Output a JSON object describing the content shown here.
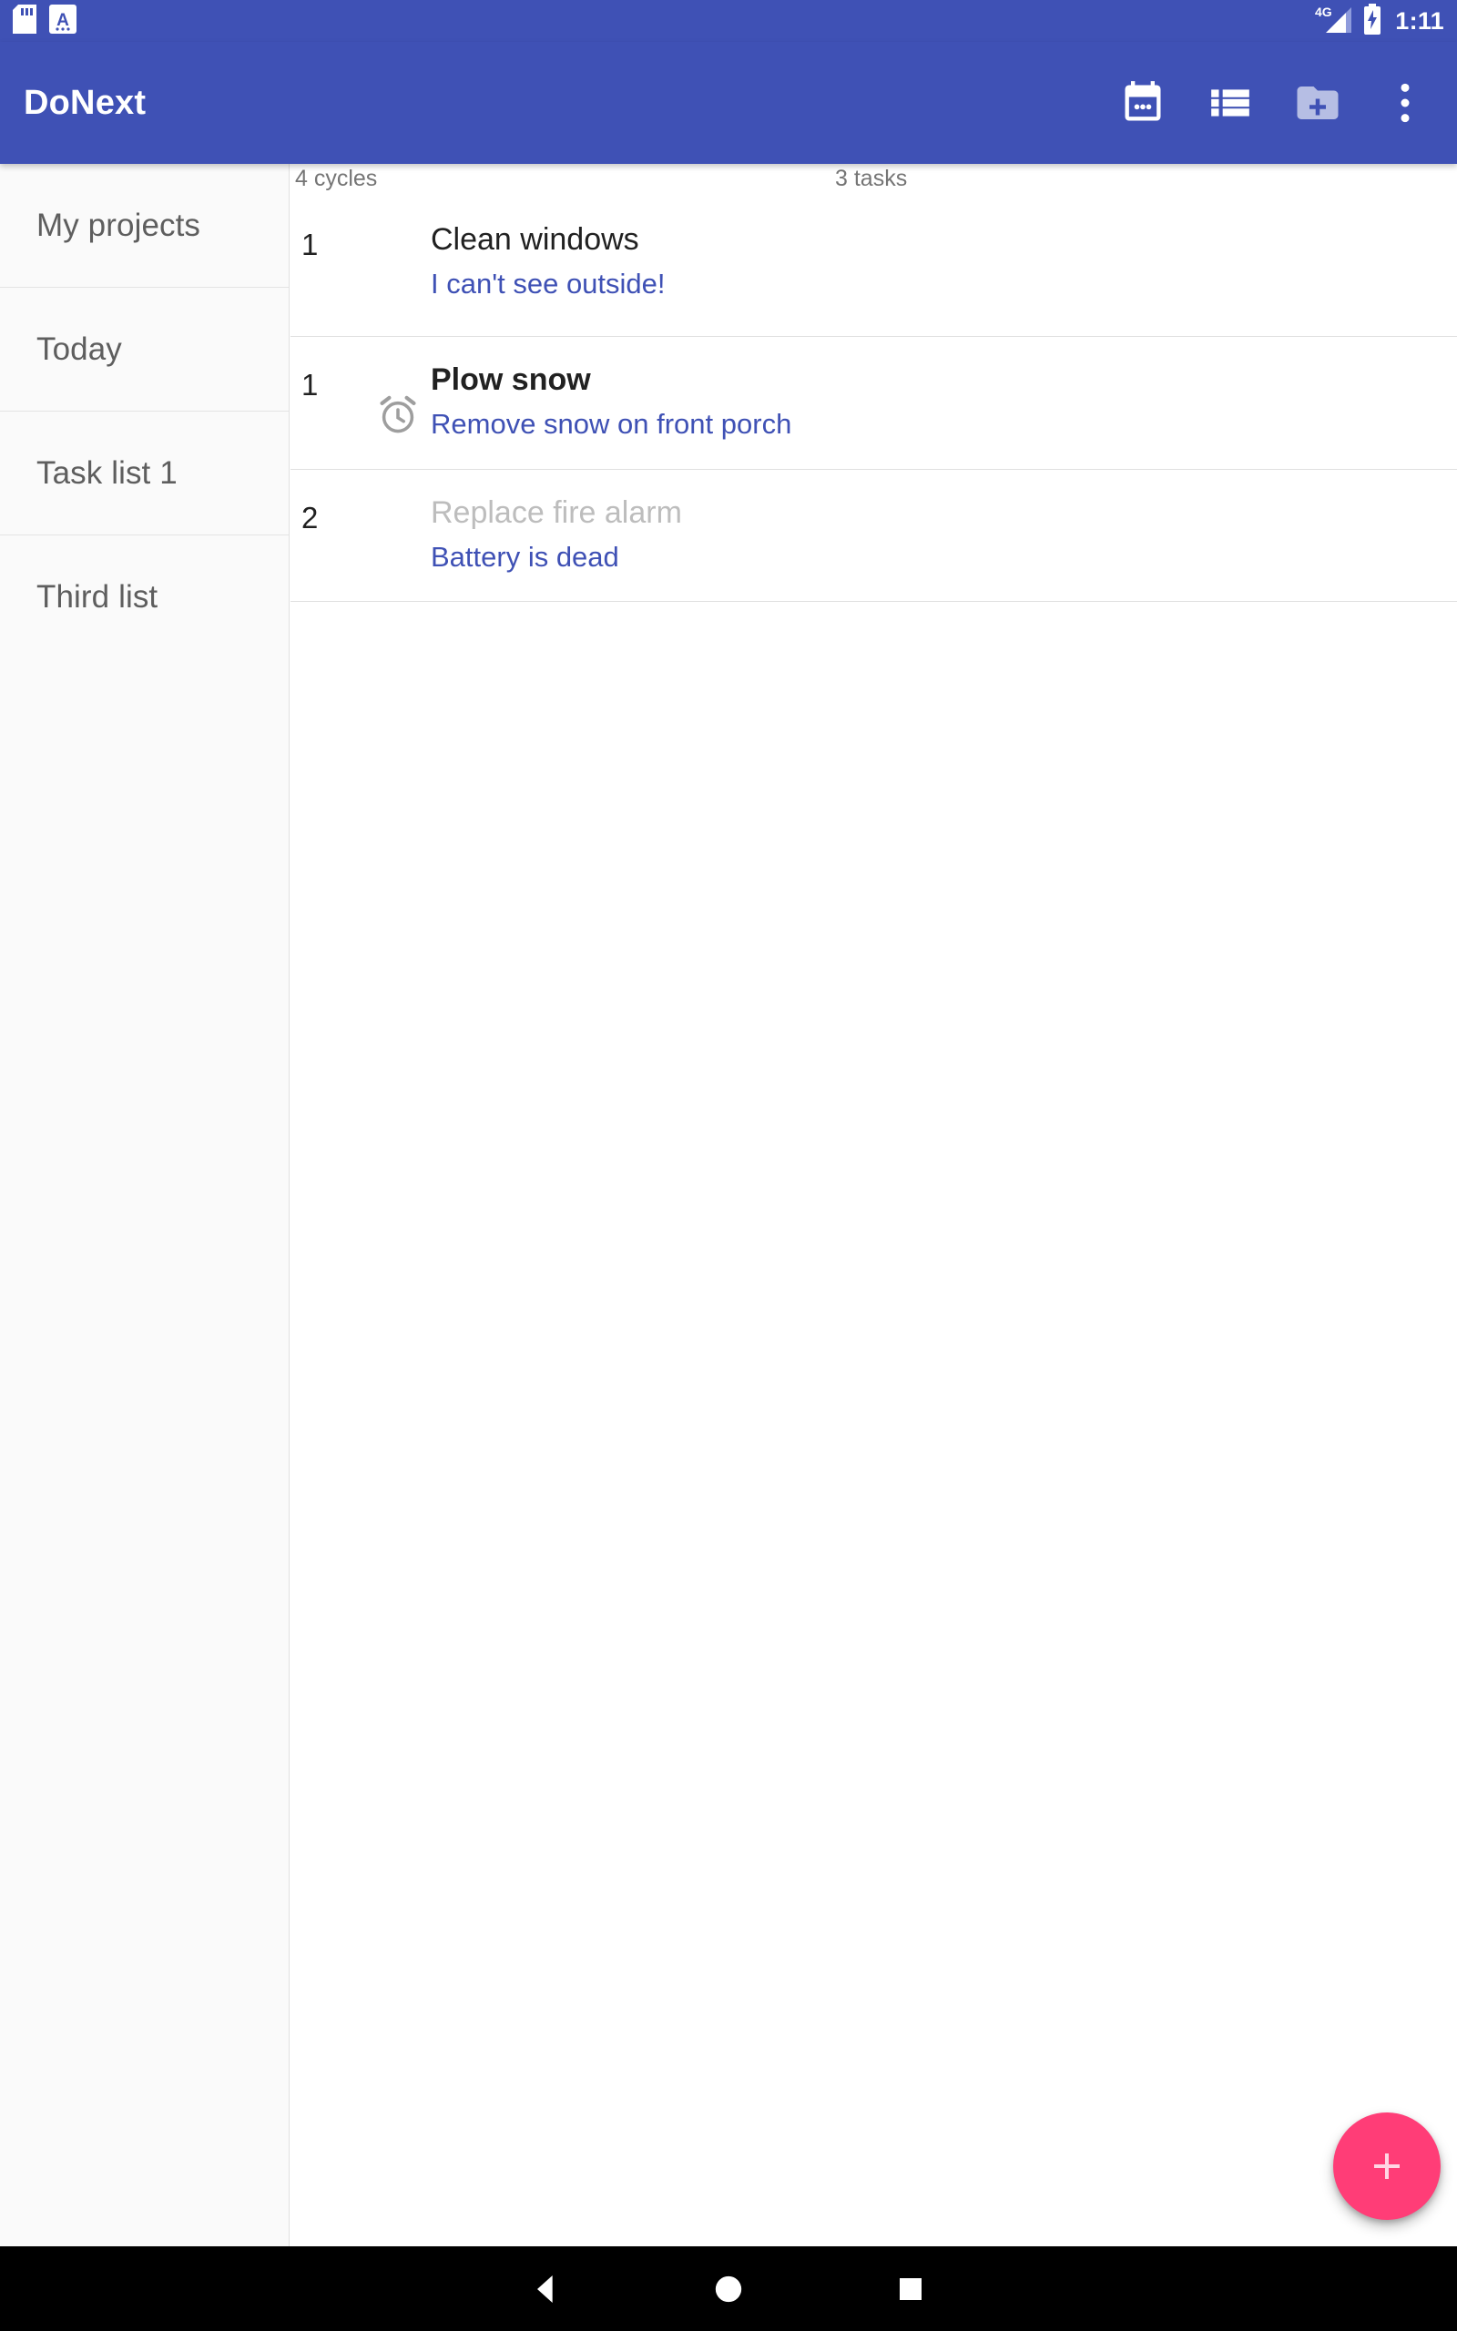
{
  "status_bar": {
    "left_icons": [
      {
        "name": "sd-card-icon",
        "label": "SD card"
      },
      {
        "name": "font-size-icon",
        "label": "A"
      }
    ],
    "network": "4G",
    "battery": "charging",
    "time": "1:11",
    "background": "#3F51B5"
  },
  "app_bar": {
    "title": "DoNext",
    "background": "#3F51B5",
    "actions": [
      {
        "name": "calendar-icon",
        "label": "Calendar"
      },
      {
        "name": "list-icon",
        "label": "List view"
      },
      {
        "name": "new-folder-icon",
        "label": "New list",
        "disabled": true
      },
      {
        "name": "overflow-menu-icon",
        "label": "More options"
      }
    ]
  },
  "sidebar": {
    "background": "#FAFAFA",
    "items": [
      {
        "label": "My projects"
      },
      {
        "label": "Today"
      },
      {
        "label": "Task list 1"
      },
      {
        "label": "Third list"
      }
    ]
  },
  "main": {
    "headers": {
      "cycles": "4 cycles",
      "tasks": "3 tasks"
    },
    "tasks": [
      {
        "cycles": "1",
        "title": "Clean windows",
        "note": "I can't see outside!",
        "bold": false,
        "dim": false,
        "alarm": false
      },
      {
        "cycles": "1",
        "title": "Plow snow",
        "note": "Remove snow on front porch",
        "bold": true,
        "dim": false,
        "alarm": true
      },
      {
        "cycles": "2",
        "title": "Replace fire alarm",
        "note": "Battery is dead",
        "bold": false,
        "dim": true,
        "alarm": false
      }
    ]
  },
  "fab": {
    "name": "add-task-fab",
    "label": "+",
    "color": "#FF3D77"
  },
  "nav_bar": {
    "background": "#000000",
    "buttons": [
      {
        "name": "nav-back-button",
        "label": "Back"
      },
      {
        "name": "nav-home-button",
        "label": "Home"
      },
      {
        "name": "nav-recents-button",
        "label": "Recents"
      }
    ]
  },
  "colors": {
    "primary": "#3F51B5",
    "accent": "#FF3D77",
    "note_text": "#3F51B5",
    "dim_text": "#BDBDBD",
    "divider": "#E0E0E0"
  }
}
